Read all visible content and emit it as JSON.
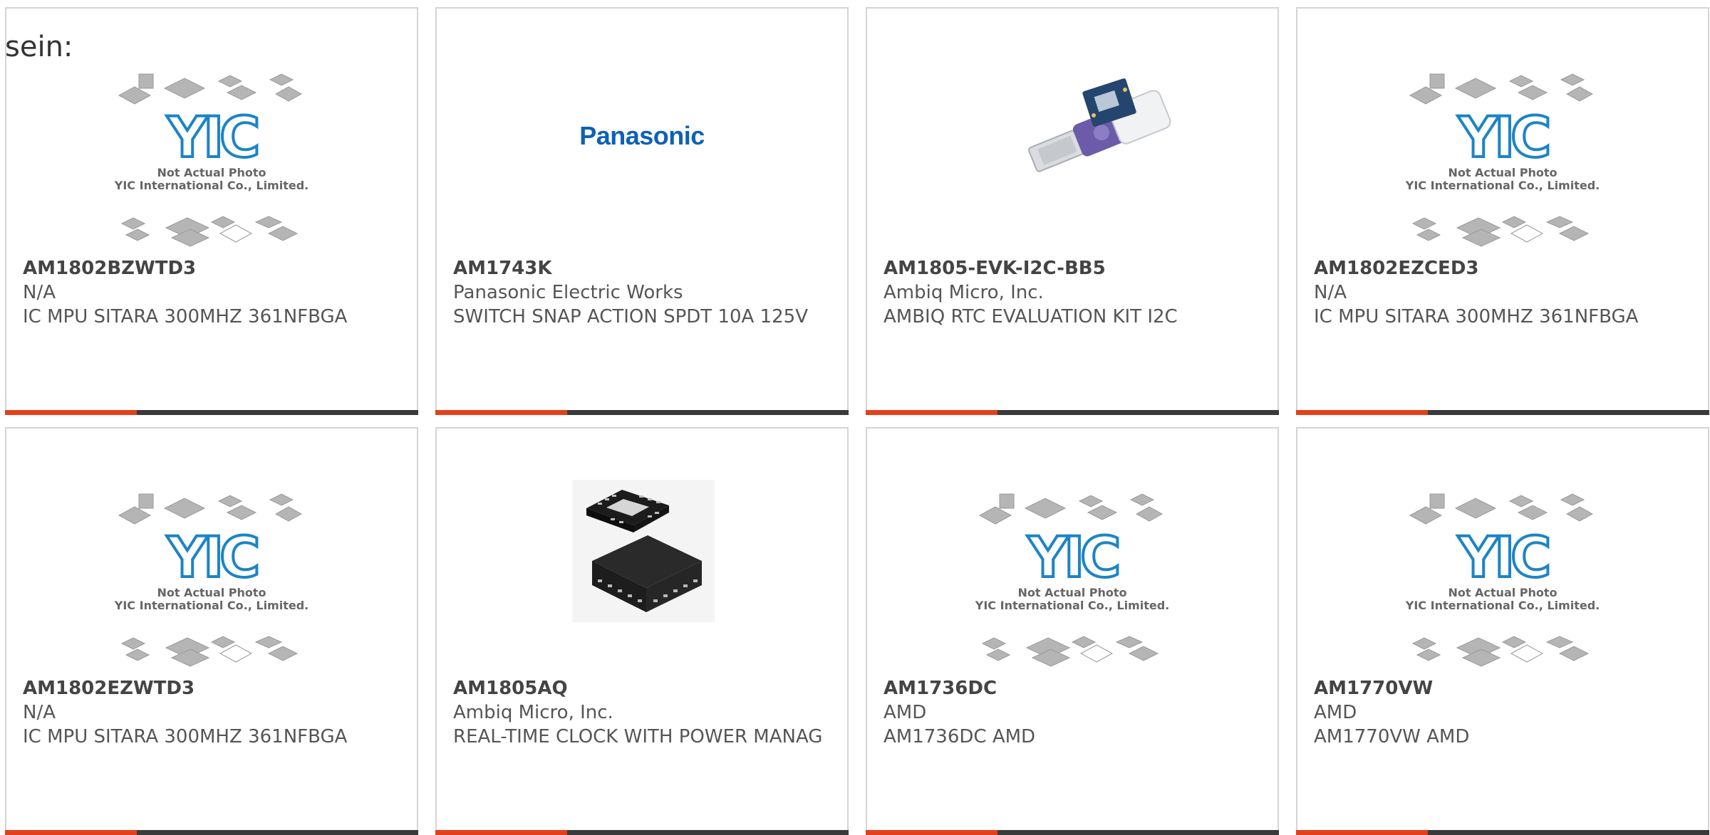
{
  "intro_text": "sein:",
  "placeholder": {
    "logo": "YIC",
    "line1": "Not Actual Photo",
    "line2": "YIC International Co., Limited."
  },
  "colors": {
    "accent": "#e2401c",
    "bar": "#3a3a3a",
    "yic_blue": "#1c84c6",
    "panasonic_blue": "#0d61b8"
  },
  "products": [
    {
      "part_number": "AM1802BZWTD3",
      "manufacturer": "N/A",
      "description": "IC MPU SITARA 300MHZ 361NFBGA",
      "image": "placeholder"
    },
    {
      "part_number": "AM1743K",
      "manufacturer": "Panasonic Electric Works",
      "description": "SWITCH SNAP ACTION SPDT 10A 125V",
      "image": "panasonic-logo",
      "brand_text": "Panasonic"
    },
    {
      "part_number": "AM1805-EVK-I2C-BB5",
      "manufacturer": "Ambiq Micro, Inc.",
      "description": "AMBIQ RTC EVALUATION KIT I2C",
      "image": "usb-eval-kit"
    },
    {
      "part_number": "AM1802EZCED3",
      "manufacturer": "N/A",
      "description": "IC MPU SITARA 300MHZ 361NFBGA",
      "image": "placeholder"
    },
    {
      "part_number": "AM1802EZWTD3",
      "manufacturer": "N/A",
      "description": "IC MPU SITARA 300MHZ 361NFBGA",
      "image": "placeholder"
    },
    {
      "part_number": "AM1805AQ",
      "manufacturer": "Ambiq Micro, Inc.",
      "description": "REAL-TIME CLOCK WITH POWER MANAG",
      "image": "qfn-chip"
    },
    {
      "part_number": "AM1736DC",
      "manufacturer": "AMD",
      "description": "AM1736DC AMD",
      "image": "placeholder"
    },
    {
      "part_number": "AM1770VW",
      "manufacturer": "AMD",
      "description": "AM1770VW AMD",
      "image": "placeholder"
    }
  ]
}
